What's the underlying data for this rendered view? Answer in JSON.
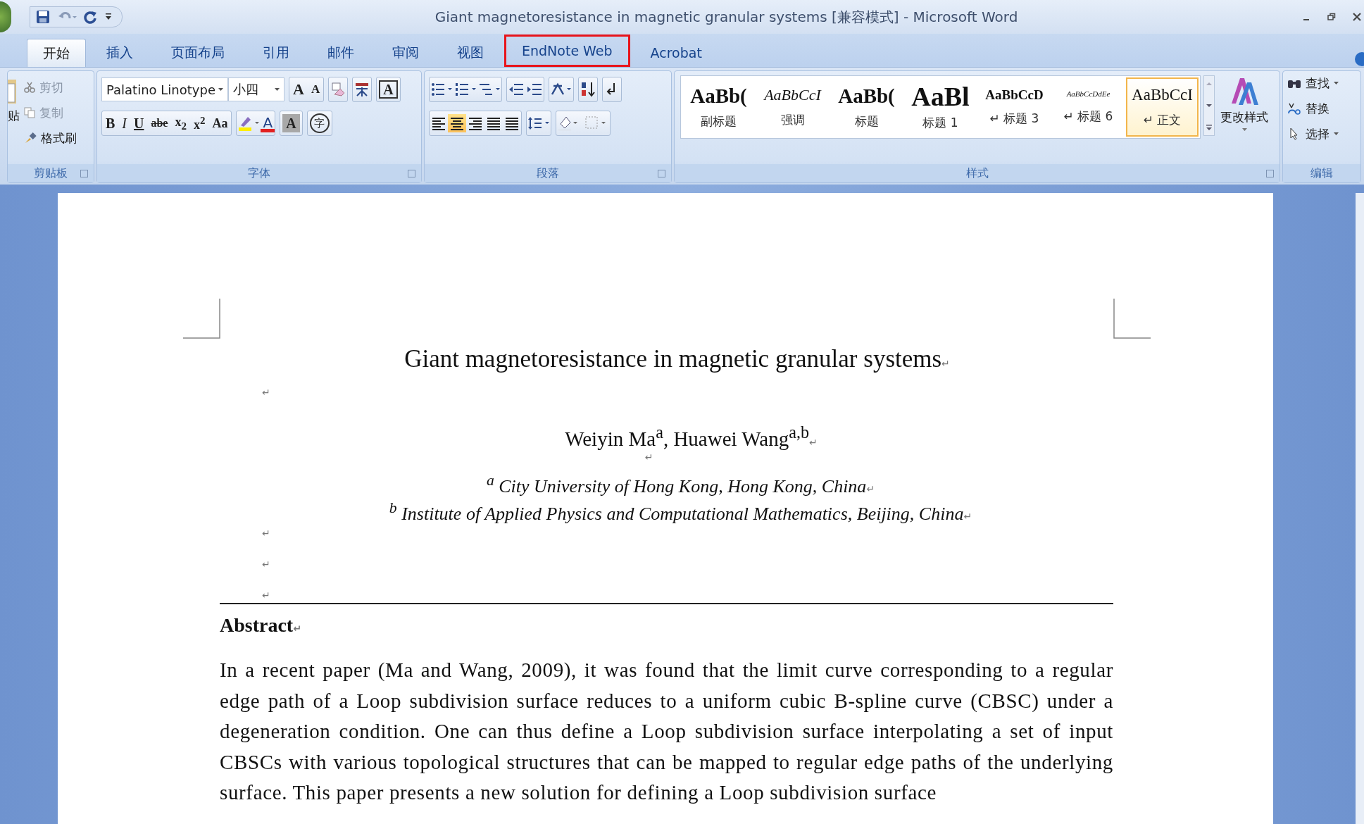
{
  "window": {
    "title": "Giant magnetoresistance in magnetic granular systems [兼容模式] - Microsoft Word"
  },
  "tabs": [
    {
      "label": "开始",
      "selected": true,
      "outlined": false
    },
    {
      "label": "插入",
      "selected": false,
      "outlined": false
    },
    {
      "label": "页面布局",
      "selected": false,
      "outlined": false
    },
    {
      "label": "引用",
      "selected": false,
      "outlined": false
    },
    {
      "label": "邮件",
      "selected": false,
      "outlined": false
    },
    {
      "label": "审阅",
      "selected": false,
      "outlined": false
    },
    {
      "label": "视图",
      "selected": false,
      "outlined": false
    },
    {
      "label": "EndNote Web",
      "selected": false,
      "outlined": true
    },
    {
      "label": "Acrobat",
      "selected": false,
      "outlined": false
    }
  ],
  "ribbon": {
    "clipboard": {
      "label": "剪贴板",
      "paste_label": "贴",
      "items": [
        "剪切",
        "复制",
        "格式刷"
      ]
    },
    "font": {
      "label": "字体",
      "font_name": "Palatino Linotype",
      "font_size": "小四",
      "row1_letters": [
        {
          "label": "A",
          "kind": "grow"
        },
        {
          "label": "A",
          "kind": "shrink"
        }
      ],
      "row1_end": [
        {
          "label": "A",
          "kind": "border"
        }
      ],
      "row2": [
        {
          "label": "B",
          "kind": "bold"
        },
        {
          "label": "I",
          "kind": "italic"
        },
        {
          "label": "U",
          "kind": "underline"
        },
        {
          "label": "abe",
          "kind": "strike"
        },
        {
          "label": "x$_{2}$",
          "kind": "plain"
        },
        {
          "label": "x$^{2}$",
          "kind": "plain"
        },
        {
          "label": "Aa",
          "kind": "case"
        },
        {
          "label": "A",
          "kind": "color"
        },
        {
          "label": "A",
          "kind": "shaded"
        },
        {
          "label": "字",
          "kind": "circled"
        }
      ]
    },
    "paragraph": {
      "label": "段落",
      "alignments": [
        {
          "selected": false
        },
        {
          "selected": true
        },
        {
          "selected": false
        },
        {
          "selected": false
        },
        {
          "selected": false
        }
      ]
    },
    "styles": {
      "label": "样式",
      "change_label": "更改样式",
      "items": [
        {
          "sample": "AaBb(",
          "name": "副标题",
          "kind": "subtitle",
          "selected": false
        },
        {
          "sample": "AaBbCcI",
          "name": "强调",
          "kind": "emphasis",
          "selected": false
        },
        {
          "sample": "AaBb(",
          "name": "标题",
          "kind": "title",
          "selected": false
        },
        {
          "sample": "AaBl",
          "name": "标题 1",
          "kind": "h1",
          "selected": false
        },
        {
          "sample": "AaBbCcD",
          "name": "↵ 标题 3",
          "kind": "h3",
          "selected": false
        },
        {
          "sample": "AaBbCcDdEe",
          "name": "↵ 标题 6",
          "kind": "h6",
          "selected": false
        },
        {
          "sample": "AaBbCcI",
          "name": "↵ 正文",
          "kind": "normal",
          "selected": true
        }
      ]
    },
    "editing": {
      "label": "编辑",
      "items": [
        {
          "label": "查找",
          "kind": "find"
        },
        {
          "label": "替换",
          "kind": "replace"
        },
        {
          "label": "选择",
          "kind": "select"
        }
      ]
    }
  },
  "document": {
    "blocks": [
      {
        "kind": "title",
        "text": "Giant magnetoresistance in magnetic granular systems",
        "mark": "↵"
      },
      {
        "kind": "empty",
        "mark": "↵"
      },
      {
        "kind": "authors",
        "text": "Weiyin Ma$^{a}$, Huawei Wang$^{a,b}$",
        "mark": "↵"
      },
      {
        "kind": "empty-center",
        "mark": "↵"
      },
      {
        "kind": "affiliation",
        "text": "$^{a}$ City University of Hong Kong, Hong Kong, China",
        "mark": "↵"
      },
      {
        "kind": "affiliation",
        "text": "$^{b}$ Institute of Applied Physics and Computational Mathematics, Beijing, China",
        "mark": "↵"
      },
      {
        "kind": "empty",
        "mark": "↵"
      },
      {
        "kind": "empty",
        "mark": "↵"
      },
      {
        "kind": "rule",
        "mark": "↵"
      },
      {
        "kind": "heading",
        "text": "Abstract",
        "mark": "↵"
      },
      {
        "kind": "body",
        "text": "In a recent paper (Ma and Wang, 2009), it was found that the limit curve corresponding to a regular edge path of a Loop subdivision surface reduces to a uniform cubic B-spline curve (CBSC) under a degeneration condition. One can thus define a Loop subdivision surface interpolating a set of input CBSCs with various topological structures that can be mapped to regular edge paths of the underlying surface. This paper presents a new solution for defining a Loop subdivision surface"
      }
    ]
  }
}
